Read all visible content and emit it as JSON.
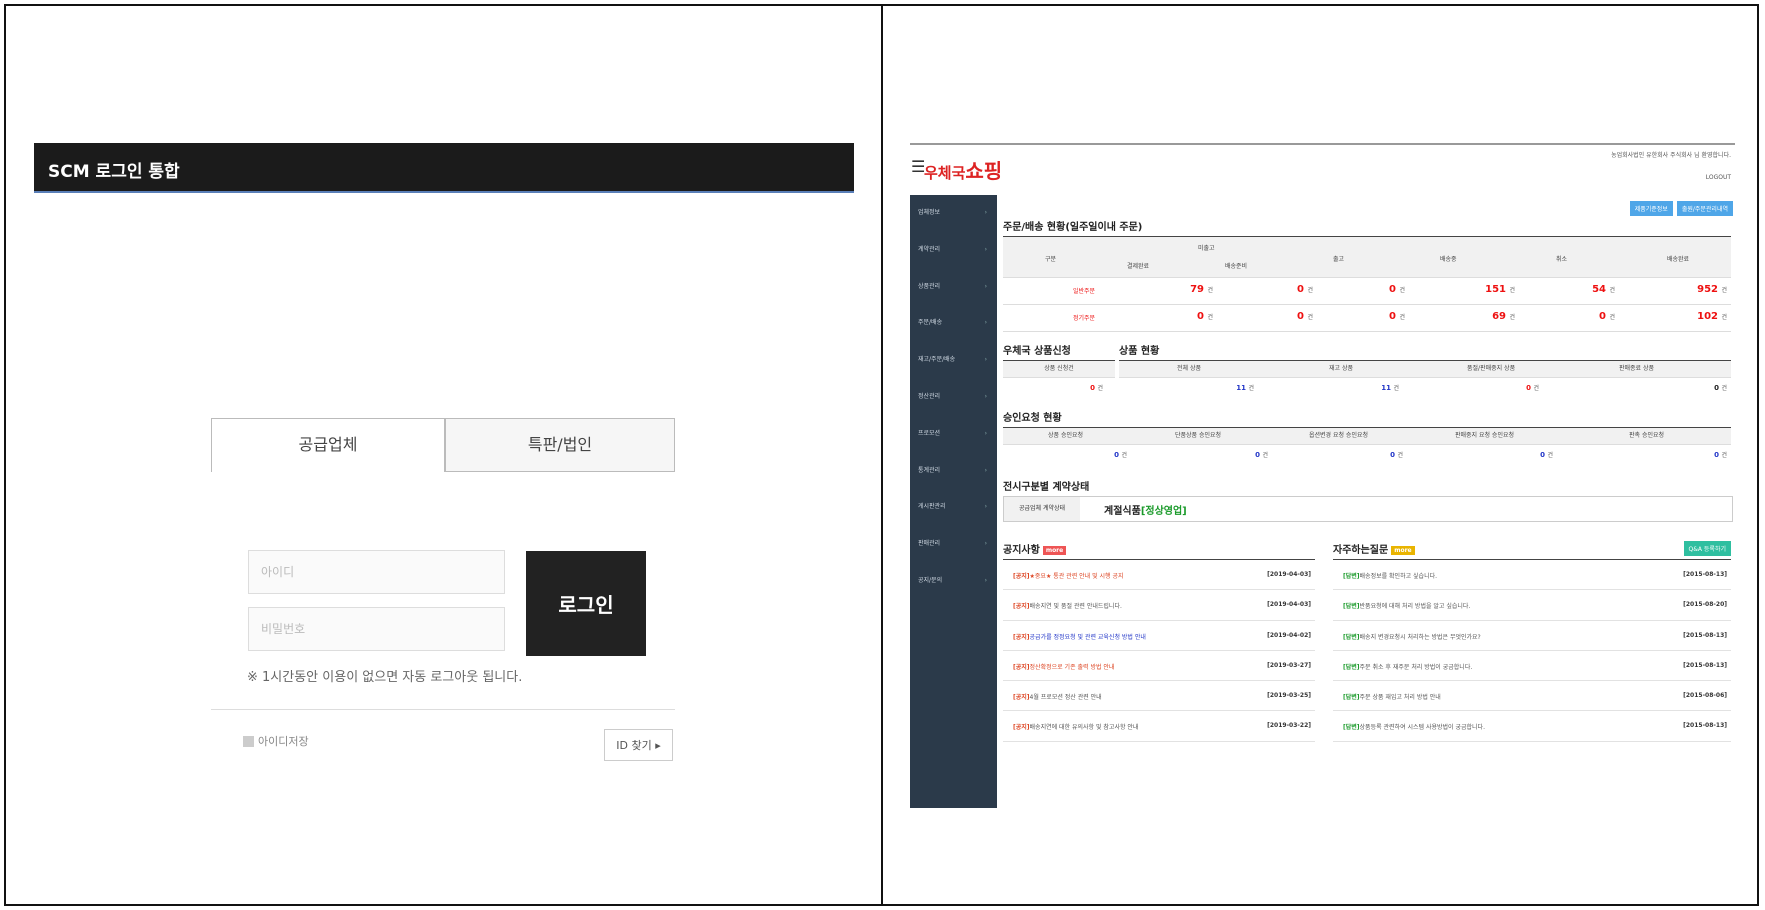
{
  "login": {
    "header_title": "SCM 로그인 통합",
    "tabs": [
      "공급업체",
      "특판/법인"
    ],
    "id_placeholder": "아이디",
    "pw_placeholder": "비밀번호",
    "login_button": "로그인",
    "logout_notice": "※ 1시간동안 이용이 없으면 자동 로그아웃 됩니다.",
    "remember_label": "아이디저장",
    "find_id_button": "ID 찾기 ▸"
  },
  "shop": {
    "logo_prefix": "우체국",
    "logo_main": "쇼핑",
    "welcome": "농업회사법인 유한회사 주식회사 님 환영합니다.",
    "logout": "LOGOUT",
    "top_buttons": [
      "제품기준정보",
      "출원/주문관리내역"
    ],
    "sidebar": [
      "업체정보",
      "계약관리",
      "상품관리",
      "주문/배송",
      "재고/주문/배송",
      "정산관리",
      "프로모션",
      "통계관리",
      "게시판관리",
      "판매관리",
      "공지/문의"
    ],
    "orders": {
      "title": "주문/배송 현황(일주일이내 주문)",
      "headers": [
        "구분",
        "미출고",
        "결제완료",
        "배송준비",
        "출고",
        "배송중",
        "취소",
        "배송완료"
      ],
      "rows": [
        {
          "label": "일반주문",
          "values": [
            "79",
            "0",
            "0",
            "151",
            "54",
            "952"
          ]
        },
        {
          "label": "정기주문",
          "values": [
            "0",
            "0",
            "0",
            "69",
            "0",
            "102"
          ]
        }
      ],
      "unit": "건"
    },
    "post_goods": {
      "title": "우체국 상품신청",
      "headers": [
        "상품 신청건"
      ],
      "values": [
        "0"
      ]
    },
    "goods": {
      "title": "상품 현황",
      "headers": [
        "전체 상품",
        "재고 상품",
        "품절/판매중지 상품",
        "판매종료 상품"
      ],
      "values": [
        "11",
        "11",
        "0",
        "0"
      ]
    },
    "approval": {
      "title": "승인요청 현황",
      "headers": [
        "상품 승인요청",
        "단품상품 승인요청",
        "옵션변경 요청 승인요청",
        "판매중지 요청 승인요청",
        "판촉 승인요청"
      ],
      "values": [
        "0",
        "0",
        "0",
        "0",
        "0"
      ]
    },
    "contract": {
      "title": "전시구분별 계약상태",
      "label": "공급업체 계약상태",
      "value": "계절식품",
      "status": "[정상영업]"
    },
    "notice": {
      "title": "공지사항",
      "badge": "more",
      "items": [
        {
          "tag": "[공지]",
          "text": "★중요★ 통관 관련 안내 및 시행 공지",
          "date": "[2019-04-03]",
          "color": "#d42"
        },
        {
          "tag": "[공지]",
          "text": "배송지연 및 품절 관련 안내드립니다.",
          "date": "[2019-04-03]",
          "color": "#777"
        },
        {
          "tag": "[공지]",
          "text": "공급가를 정정요청 및 관련 교육신청 방법 안내",
          "date": "[2019-04-02]",
          "color": "#2236c8"
        },
        {
          "tag": "[공지]",
          "text": "정산확정으로 기존 출력 방법 안내",
          "date": "[2019-03-27]",
          "color": "#d42"
        },
        {
          "tag": "[공지]",
          "text": "4월 프로모션 정산 관련 안내",
          "date": "[2019-03-25]",
          "color": "#777"
        },
        {
          "tag": "[공지]",
          "text": "배송지연에 대한 유의사항 및 참고사항 안내",
          "date": "[2019-03-22]",
          "color": "#777"
        }
      ]
    },
    "faq": {
      "title": "자주하는질문",
      "badge": "more",
      "button": "Q&A 등록하기",
      "items": [
        {
          "tag": "[답변]",
          "text": "배송정보를 확인하고 싶습니다.",
          "date": "[2015-08-13]"
        },
        {
          "tag": "[답변]",
          "text": "반품요청에 대해 처리 방법을 알고 싶습니다.",
          "date": "[2015-08-20]"
        },
        {
          "tag": "[답변]",
          "text": "배송지 변경요청시 처리하는 방법은 무엇인가요?",
          "date": "[2015-08-13]"
        },
        {
          "tag": "[답변]",
          "text": "주문 취소 후 재주문 처리 방법이 궁금합니다.",
          "date": "[2015-08-13]"
        },
        {
          "tag": "[답변]",
          "text": "주문 상품 재입고 처리 방법 안내",
          "date": "[2015-08-06]"
        },
        {
          "tag": "[답변]",
          "text": "상품등록 관련하여 시스템 사용방법이 궁금합니다.",
          "date": "[2015-08-13]"
        }
      ]
    }
  },
  "colors": {
    "header_bg": "#1b1b1b",
    "accent_red": "#e11",
    "accent_blue": "#2236c8",
    "sidebar": "#2b3a4a"
  }
}
